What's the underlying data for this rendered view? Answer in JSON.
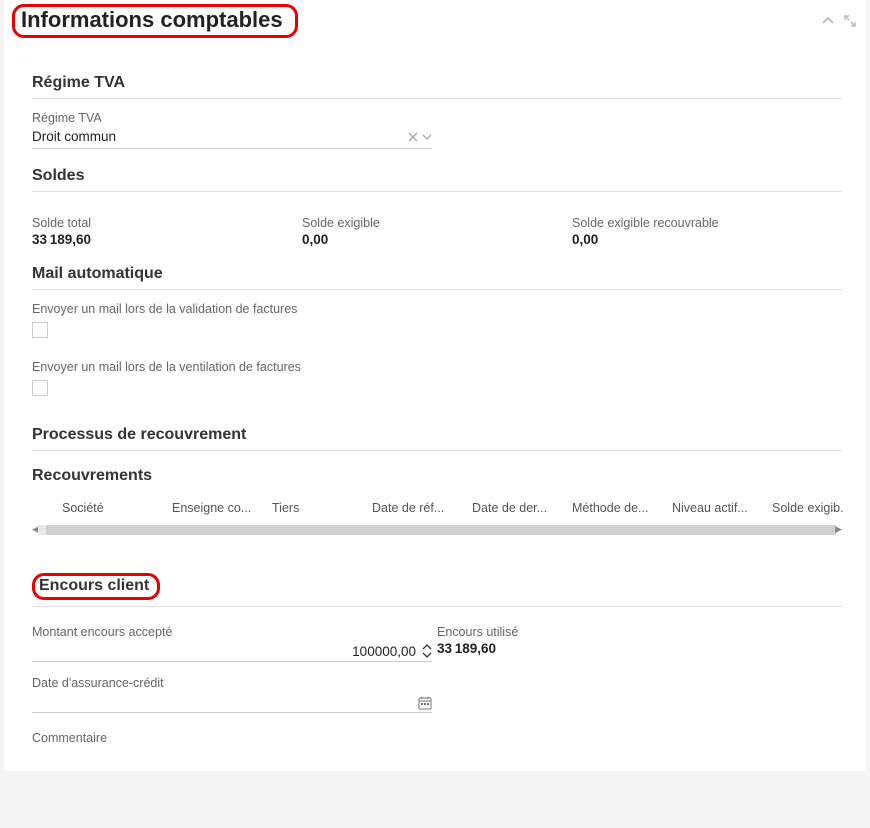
{
  "panel": {
    "title": "Informations comptables"
  },
  "regimeTva": {
    "section_title": "Régime TVA",
    "field_label": "Régime TVA",
    "value": "Droit commun"
  },
  "soldes": {
    "section_title": "Soldes",
    "total": {
      "label": "Solde total",
      "value": "33 189,60"
    },
    "exigible": {
      "label": "Solde exigible",
      "value": "0,00"
    },
    "exigible_recouvrable": {
      "label": "Solde exigible recouvrable",
      "value": "0,00"
    }
  },
  "mailAuto": {
    "section_title": "Mail automatique",
    "validation_label": "Envoyer un mail lors de la validation de factures",
    "ventilation_label": "Envoyer un mail lors de la ventilation de factures"
  },
  "processus": {
    "section_title": "Processus de recouvrement"
  },
  "recouvrements": {
    "section_title": "Recouvrements",
    "columns": {
      "societe": "Société",
      "enseigne": "Enseigne co...",
      "tiers": "Tiers",
      "date_ref": "Date de réf...",
      "date_der": "Date de der...",
      "methode": "Méthode de...",
      "niveau": "Niveau actif...",
      "solde_exigib": "Solde exigib."
    }
  },
  "encours": {
    "section_title": "Encours client",
    "montant_label": "Montant encours accepté",
    "montant_value": "100000,00",
    "utilise_label": "Encours utilisé",
    "utilise_value": "33 189,60",
    "date_assurance_label": "Date d'assurance-crédit",
    "commentaire_label": "Commentaire"
  }
}
